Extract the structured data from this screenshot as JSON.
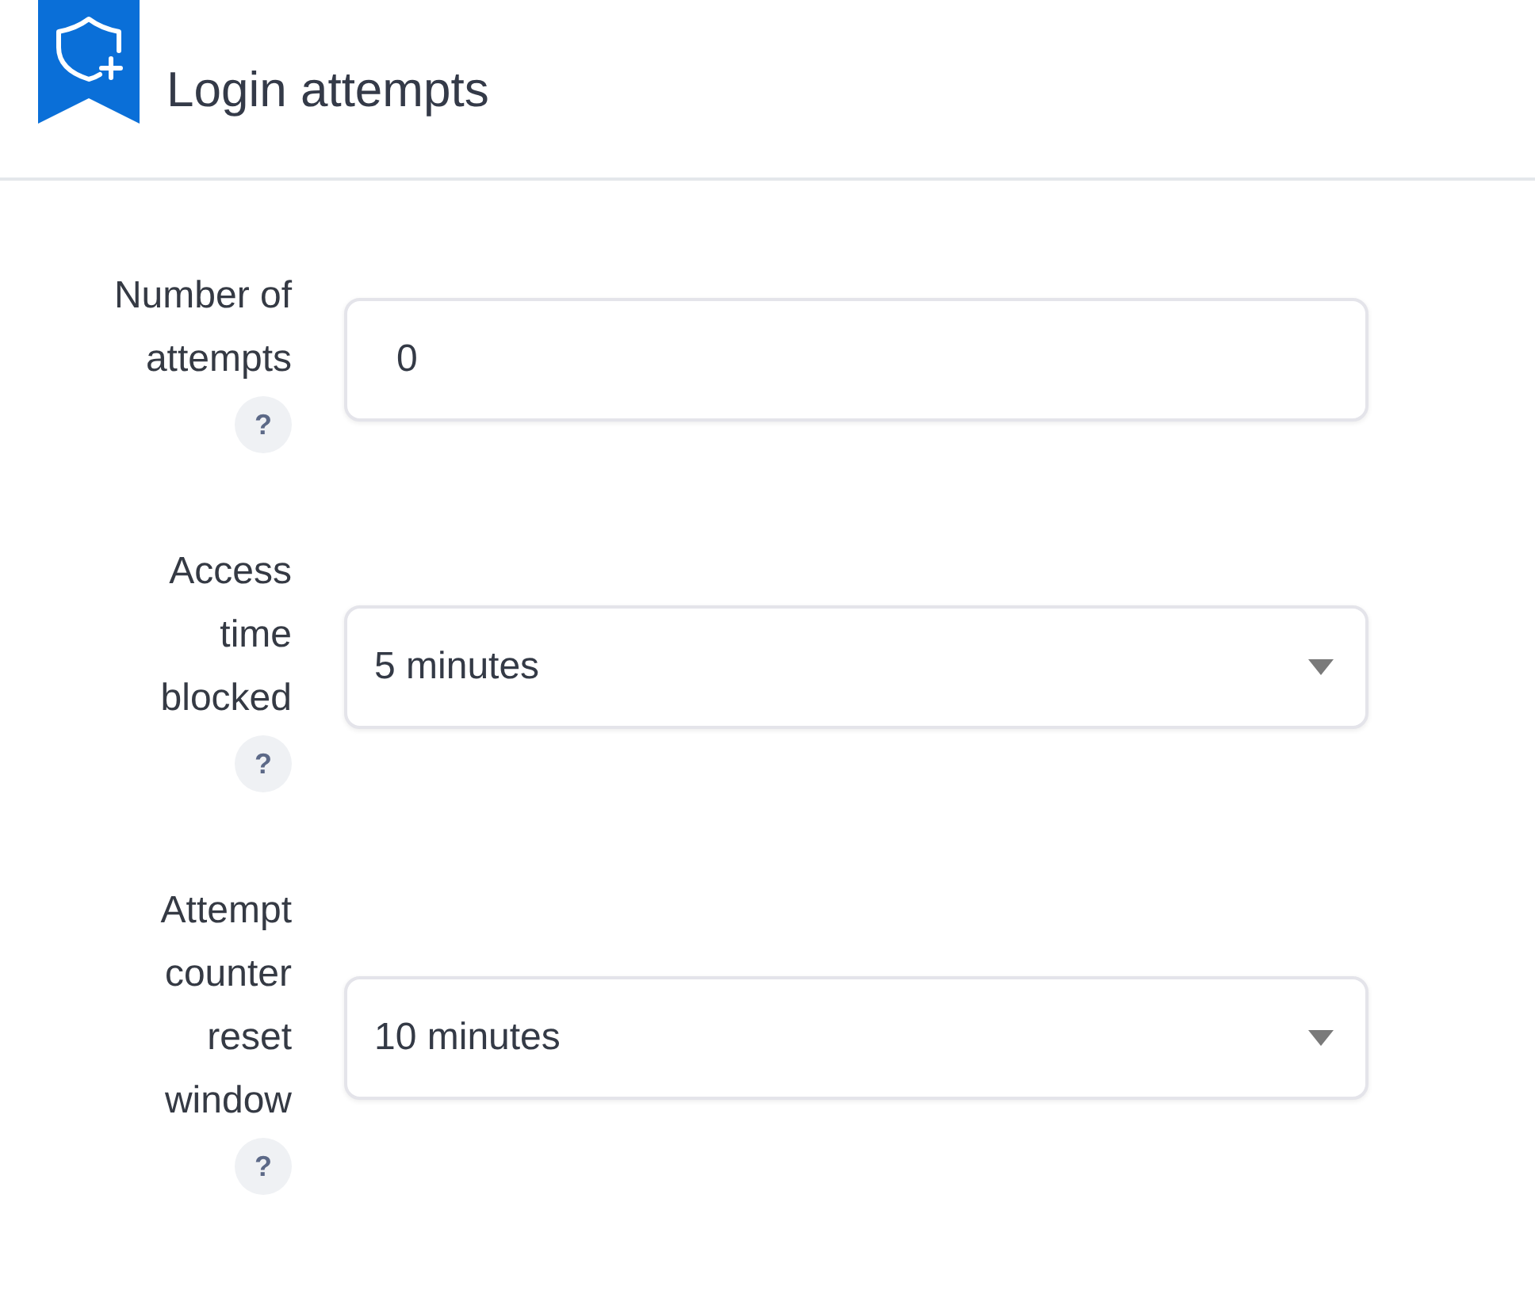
{
  "header": {
    "title": "Login attempts"
  },
  "fields": [
    {
      "kind": "input",
      "label": "Number of attempts",
      "value": "0",
      "help": "?"
    },
    {
      "kind": "select",
      "label": "Access time blocked",
      "value": "5 minutes",
      "help": "?"
    },
    {
      "kind": "select",
      "label": "Attempt counter reset window",
      "value": "10 minutes",
      "help": "?"
    }
  ]
}
